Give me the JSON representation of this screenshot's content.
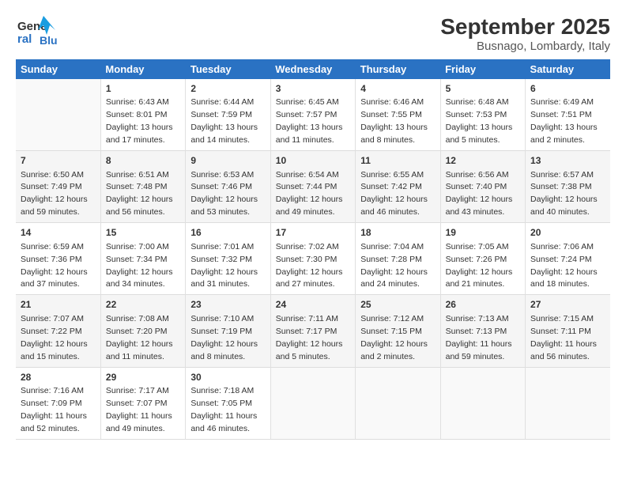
{
  "logo": {
    "line1": "General",
    "line2": "Blue"
  },
  "title": "September 2025",
  "subtitle": "Busnago, Lombardy, Italy",
  "days_header": [
    "Sunday",
    "Monday",
    "Tuesday",
    "Wednesday",
    "Thursday",
    "Friday",
    "Saturday"
  ],
  "weeks": [
    [
      {
        "day": "",
        "sunrise": "",
        "sunset": "",
        "daylight": ""
      },
      {
        "day": "1",
        "sunrise": "Sunrise: 6:43 AM",
        "sunset": "Sunset: 8:01 PM",
        "daylight": "Daylight: 13 hours and 17 minutes."
      },
      {
        "day": "2",
        "sunrise": "Sunrise: 6:44 AM",
        "sunset": "Sunset: 7:59 PM",
        "daylight": "Daylight: 13 hours and 14 minutes."
      },
      {
        "day": "3",
        "sunrise": "Sunrise: 6:45 AM",
        "sunset": "Sunset: 7:57 PM",
        "daylight": "Daylight: 13 hours and 11 minutes."
      },
      {
        "day": "4",
        "sunrise": "Sunrise: 6:46 AM",
        "sunset": "Sunset: 7:55 PM",
        "daylight": "Daylight: 13 hours and 8 minutes."
      },
      {
        "day": "5",
        "sunrise": "Sunrise: 6:48 AM",
        "sunset": "Sunset: 7:53 PM",
        "daylight": "Daylight: 13 hours and 5 minutes."
      },
      {
        "day": "6",
        "sunrise": "Sunrise: 6:49 AM",
        "sunset": "Sunset: 7:51 PM",
        "daylight": "Daylight: 13 hours and 2 minutes."
      }
    ],
    [
      {
        "day": "7",
        "sunrise": "Sunrise: 6:50 AM",
        "sunset": "Sunset: 7:49 PM",
        "daylight": "Daylight: 12 hours and 59 minutes."
      },
      {
        "day": "8",
        "sunrise": "Sunrise: 6:51 AM",
        "sunset": "Sunset: 7:48 PM",
        "daylight": "Daylight: 12 hours and 56 minutes."
      },
      {
        "day": "9",
        "sunrise": "Sunrise: 6:53 AM",
        "sunset": "Sunset: 7:46 PM",
        "daylight": "Daylight: 12 hours and 53 minutes."
      },
      {
        "day": "10",
        "sunrise": "Sunrise: 6:54 AM",
        "sunset": "Sunset: 7:44 PM",
        "daylight": "Daylight: 12 hours and 49 minutes."
      },
      {
        "day": "11",
        "sunrise": "Sunrise: 6:55 AM",
        "sunset": "Sunset: 7:42 PM",
        "daylight": "Daylight: 12 hours and 46 minutes."
      },
      {
        "day": "12",
        "sunrise": "Sunrise: 6:56 AM",
        "sunset": "Sunset: 7:40 PM",
        "daylight": "Daylight: 12 hours and 43 minutes."
      },
      {
        "day": "13",
        "sunrise": "Sunrise: 6:57 AM",
        "sunset": "Sunset: 7:38 PM",
        "daylight": "Daylight: 12 hours and 40 minutes."
      }
    ],
    [
      {
        "day": "14",
        "sunrise": "Sunrise: 6:59 AM",
        "sunset": "Sunset: 7:36 PM",
        "daylight": "Daylight: 12 hours and 37 minutes."
      },
      {
        "day": "15",
        "sunrise": "Sunrise: 7:00 AM",
        "sunset": "Sunset: 7:34 PM",
        "daylight": "Daylight: 12 hours and 34 minutes."
      },
      {
        "day": "16",
        "sunrise": "Sunrise: 7:01 AM",
        "sunset": "Sunset: 7:32 PM",
        "daylight": "Daylight: 12 hours and 31 minutes."
      },
      {
        "day": "17",
        "sunrise": "Sunrise: 7:02 AM",
        "sunset": "Sunset: 7:30 PM",
        "daylight": "Daylight: 12 hours and 27 minutes."
      },
      {
        "day": "18",
        "sunrise": "Sunrise: 7:04 AM",
        "sunset": "Sunset: 7:28 PM",
        "daylight": "Daylight: 12 hours and 24 minutes."
      },
      {
        "day": "19",
        "sunrise": "Sunrise: 7:05 AM",
        "sunset": "Sunset: 7:26 PM",
        "daylight": "Daylight: 12 hours and 21 minutes."
      },
      {
        "day": "20",
        "sunrise": "Sunrise: 7:06 AM",
        "sunset": "Sunset: 7:24 PM",
        "daylight": "Daylight: 12 hours and 18 minutes."
      }
    ],
    [
      {
        "day": "21",
        "sunrise": "Sunrise: 7:07 AM",
        "sunset": "Sunset: 7:22 PM",
        "daylight": "Daylight: 12 hours and 15 minutes."
      },
      {
        "day": "22",
        "sunrise": "Sunrise: 7:08 AM",
        "sunset": "Sunset: 7:20 PM",
        "daylight": "Daylight: 12 hours and 11 minutes."
      },
      {
        "day": "23",
        "sunrise": "Sunrise: 7:10 AM",
        "sunset": "Sunset: 7:19 PM",
        "daylight": "Daylight: 12 hours and 8 minutes."
      },
      {
        "day": "24",
        "sunrise": "Sunrise: 7:11 AM",
        "sunset": "Sunset: 7:17 PM",
        "daylight": "Daylight: 12 hours and 5 minutes."
      },
      {
        "day": "25",
        "sunrise": "Sunrise: 7:12 AM",
        "sunset": "Sunset: 7:15 PM",
        "daylight": "Daylight: 12 hours and 2 minutes."
      },
      {
        "day": "26",
        "sunrise": "Sunrise: 7:13 AM",
        "sunset": "Sunset: 7:13 PM",
        "daylight": "Daylight: 11 hours and 59 minutes."
      },
      {
        "day": "27",
        "sunrise": "Sunrise: 7:15 AM",
        "sunset": "Sunset: 7:11 PM",
        "daylight": "Daylight: 11 hours and 56 minutes."
      }
    ],
    [
      {
        "day": "28",
        "sunrise": "Sunrise: 7:16 AM",
        "sunset": "Sunset: 7:09 PM",
        "daylight": "Daylight: 11 hours and 52 minutes."
      },
      {
        "day": "29",
        "sunrise": "Sunrise: 7:17 AM",
        "sunset": "Sunset: 7:07 PM",
        "daylight": "Daylight: 11 hours and 49 minutes."
      },
      {
        "day": "30",
        "sunrise": "Sunrise: 7:18 AM",
        "sunset": "Sunset: 7:05 PM",
        "daylight": "Daylight: 11 hours and 46 minutes."
      },
      {
        "day": "",
        "sunrise": "",
        "sunset": "",
        "daylight": ""
      },
      {
        "day": "",
        "sunrise": "",
        "sunset": "",
        "daylight": ""
      },
      {
        "day": "",
        "sunrise": "",
        "sunset": "",
        "daylight": ""
      },
      {
        "day": "",
        "sunrise": "",
        "sunset": "",
        "daylight": ""
      }
    ]
  ]
}
